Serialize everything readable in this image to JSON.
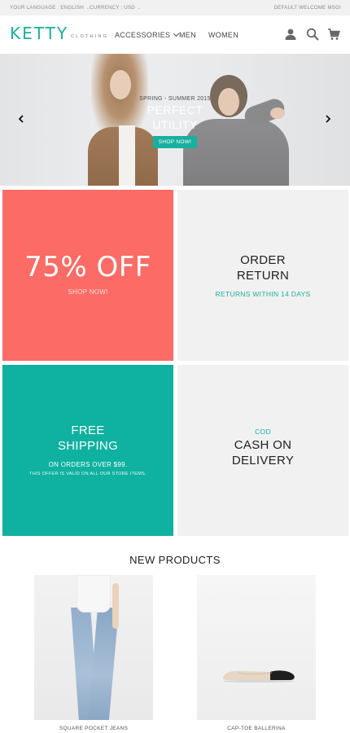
{
  "topbar": {
    "language": "YOUR LANGUAGE : ENGLISH",
    "currency": "CURRENCY : USD",
    "welcome": "DEFAULT WELCOME MSG!"
  },
  "header": {
    "logo_main": "KETTY",
    "logo_sub": "CLOTHING",
    "nav": [
      "ACCESSORIES",
      "MEN",
      "WOMEN"
    ],
    "icons": [
      "user-icon",
      "search-icon",
      "cart-icon"
    ]
  },
  "hero": {
    "subtitle": "SPRING - SUMMER 2015",
    "title_line1": "PERFECT",
    "title_line2": "UTILITY",
    "button": "SHOP NOW!"
  },
  "promos": {
    "sale": {
      "big": "75% OFF",
      "small": "SHOP NOW!"
    },
    "return": {
      "line1": "ORDER",
      "line2": "RETURN",
      "sub": "RETURNS WITHIN 14 DAYS"
    },
    "shipping": {
      "line1": "FREE",
      "line2": "SHIPPING",
      "sub1": "ON ORDERS OVER $99.",
      "sub2": "THIS OFFER IS VALID ON ALL OUR STORE ITEMS."
    },
    "cod": {
      "label": "COD",
      "line1": "CASH ON",
      "line2": "DELIVERY"
    }
  },
  "new_products": {
    "title": "NEW PRODUCTS",
    "items": [
      {
        "name": "SQUARE POCKET JEANS"
      },
      {
        "name": "CAP-TOE BALLERINA"
      }
    ]
  },
  "colors": {
    "accent": "#18b0a0",
    "coral": "#fc6b66",
    "tile_gray": "#f1f1f1"
  }
}
